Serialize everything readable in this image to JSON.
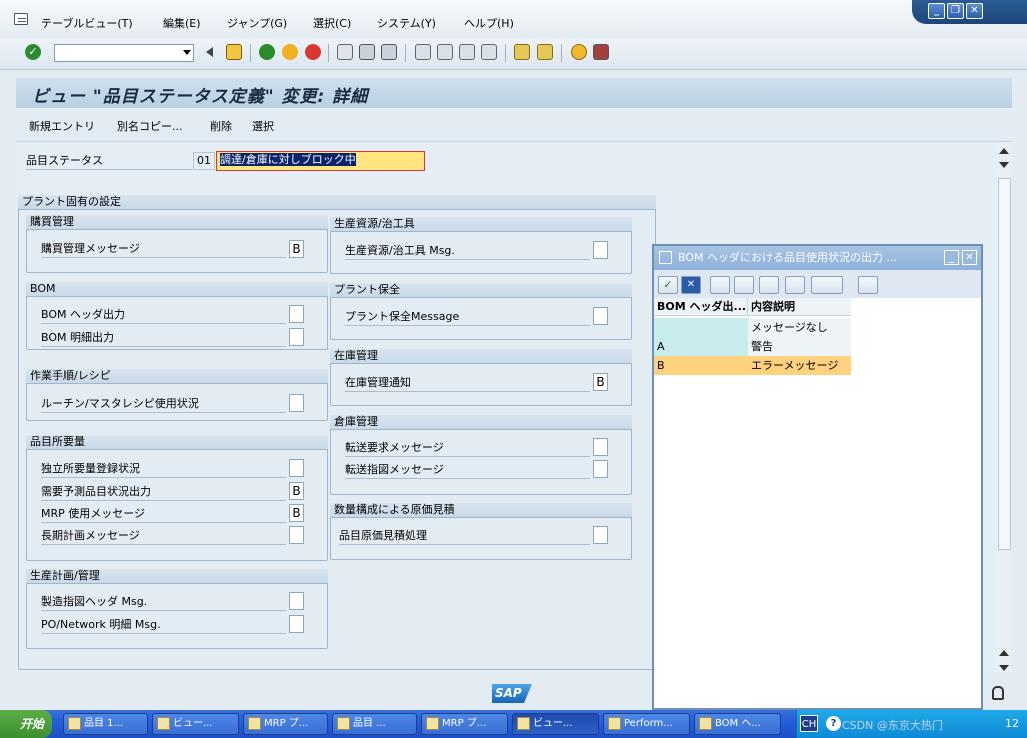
{
  "menu": [
    "テーブルビュー(T)",
    "編集(E)",
    "ジャンプ(G)",
    "選択(C)",
    "システム(Y)",
    "ヘルプ(H)"
  ],
  "window_controls": [
    "minimize",
    "restore",
    "close"
  ],
  "title": "ビュー \"品目ステータス定義\" 変更: 詳細",
  "app_toolbar": [
    "新規エントリ",
    "別名コピー...",
    "削除",
    "選択"
  ],
  "status_field": {
    "label": "品目ステータス",
    "code": "01",
    "description": "調達/倉庫に対しブロック中"
  },
  "plant_section_title": "プラント固有の設定",
  "groups": {
    "purchasing": {
      "title": "購買管理",
      "fields": [
        {
          "label": "購買管理メッセージ",
          "value": "B"
        }
      ]
    },
    "bom": {
      "title": "BOM",
      "fields": [
        {
          "label": "BOM ヘッダ出力",
          "value": ""
        },
        {
          "label": "BOM 明細出力",
          "value": ""
        }
      ]
    },
    "routing": {
      "title": "作業手順/レシピ",
      "fields": [
        {
          "label": "ルーチン/マスタレシピ使用状況",
          "value": ""
        }
      ]
    },
    "mrp": {
      "title": "品目所要量",
      "fields": [
        {
          "label": "独立所要量登録状況",
          "value": ""
        },
        {
          "label": "需要予測品目状況出力",
          "value": "B"
        },
        {
          "label": "MRP 使用メッセージ",
          "value": "B"
        },
        {
          "label": "長期計画メッセージ",
          "value": ""
        }
      ]
    },
    "production": {
      "title": "生産計画/管理",
      "fields": [
        {
          "label": "製造指図ヘッダ Msg.",
          "value": ""
        },
        {
          "label": "PO/Network 明細 Msg.",
          "value": ""
        }
      ]
    },
    "prt": {
      "title": "生産資源/治工具",
      "fields": [
        {
          "label": "生産資源/治工具 Msg.",
          "value": ""
        }
      ]
    },
    "pm": {
      "title": "プラント保全",
      "fields": [
        {
          "label": "プラント保全Message",
          "value": ""
        }
      ]
    },
    "inventory": {
      "title": "在庫管理",
      "fields": [
        {
          "label": "在庫管理通知",
          "value": "B"
        }
      ]
    },
    "warehouse": {
      "title": "倉庫管理",
      "fields": [
        {
          "label": "転送要求メッセージ",
          "value": ""
        },
        {
          "label": "転送指図メッセージ",
          "value": ""
        }
      ]
    },
    "costing": {
      "title": "数量構成による原価見積",
      "fields": [
        {
          "label": "品目原価見積処理",
          "value": ""
        }
      ]
    }
  },
  "popup": {
    "title": "BOM ヘッダにおける品目使用状況の出力 ...",
    "col1": "BOM ヘッダ出...",
    "col2": "内容説明",
    "rows": [
      {
        "code": "",
        "text": "メッセージなし"
      },
      {
        "code": "A",
        "text": "警告"
      },
      {
        "code": "B",
        "text": "エラーメッセージ"
      }
    ]
  },
  "sap_logo": "SAP",
  "taskbar": {
    "start": "开始",
    "tasks": [
      "品目 1...",
      "ビュー...",
      "MRP プ...",
      "品目 ...",
      "MRP プ...",
      "ビュー...",
      "Perform...",
      "BOM ヘ..."
    ],
    "tray": [
      "CH",
      "CSDN @东京大热门",
      "12"
    ]
  },
  "colors": {
    "accent": "#ffe680",
    "selected_row": "#ffd27f",
    "title_bg": "#c2d6ea"
  }
}
